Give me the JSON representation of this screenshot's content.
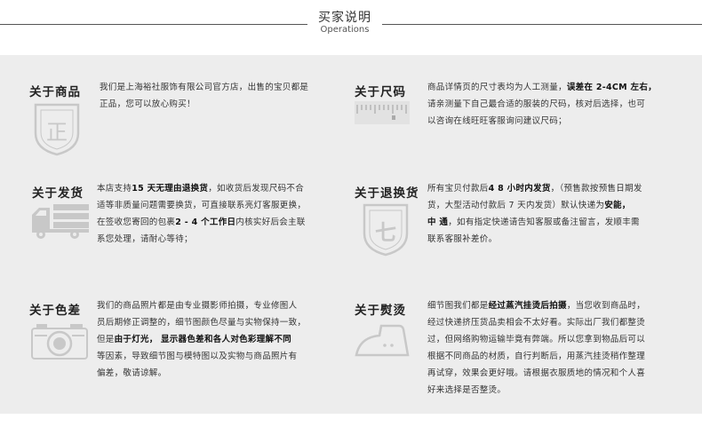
{
  "header": {
    "title": "买家说明",
    "subtitle": "Operations"
  },
  "colors": {
    "panel_bg": "#ededed",
    "icon_gray": "#c8c8c8",
    "text": "#333333"
  },
  "items": [
    {
      "id": "product",
      "title": "关于商品",
      "icon": "shield-zheng-icon",
      "icon_char": "正",
      "lines": [
        [
          {
            "t": "我们是上海裕社服饰有限公司官方店，出售的宝贝都是"
          }
        ],
        [
          {
            "t": "正品，您可以放心购买！"
          }
        ]
      ]
    },
    {
      "id": "size",
      "title": "关于尺码",
      "icon": "ruler-icon",
      "lines": [
        [
          {
            "t": "商品详情页的尺寸表均为人工测量，"
          },
          {
            "t": "误差在 2-4CM 左右，",
            "b": true
          }
        ],
        [
          {
            "t": "请亲测量下自己最合适的服装的尺码，核对后选择，也可"
          }
        ],
        [
          {
            "t": "以咨询在线旺旺客服询问建议尺码；"
          }
        ]
      ]
    },
    {
      "id": "shipping",
      "title": "关于发货",
      "icon": "truck-icon",
      "lines": [
        [
          {
            "t": "本店支持"
          },
          {
            "t": "15 天无理由退换货",
            "b": true
          },
          {
            "t": "，如收货后发现尺码不合"
          }
        ],
        [
          {
            "t": "适等非质量问题需要换货，可直接联系亮灯客服更换，"
          }
        ],
        [
          {
            "t": "在签收您寄回的包裹"
          },
          {
            "t": "2 - 4 个工作日",
            "b": true
          },
          {
            "t": "内核实好后会主联"
          }
        ],
        [
          {
            "t": "系您处理，请耐心等待；"
          }
        ]
      ]
    },
    {
      "id": "return",
      "title": "关于退换货",
      "icon": "shield-seven-icon",
      "icon_char": "七",
      "lines": [
        [
          {
            "t": "所有宝贝付款后"
          },
          {
            "t": "4 8 小时内发货",
            "b": true
          },
          {
            "t": "，（预售款按预售日期发"
          }
        ],
        [
          {
            "t": "货，大型活动付款后 7 天内发货）默认快递为"
          },
          {
            "t": "安能，",
            "b": true
          }
        ],
        [
          {
            "t": "中 通",
            "b": true
          },
          {
            "t": "，如有指定快递请告知客服或备注留言，发顺丰需"
          }
        ],
        [
          {
            "t": "联系客服补差价。"
          }
        ]
      ]
    },
    {
      "id": "color",
      "title": "关于色差",
      "icon": "camera-icon",
      "lines": [
        [
          {
            "t": "我们的商品照片都是由专业摄影师拍摄，专业修图人"
          }
        ],
        [
          {
            "t": "员后期修正调整的，细节图颜色尽量与实物保持一致，"
          }
        ],
        [
          {
            "t": "但是"
          },
          {
            "t": "由于灯光，",
            "b": true
          },
          {
            "t": "  "
          },
          {
            "t": "显示器色差和各人对色彩理解不同",
            "b": true
          }
        ],
        [
          {
            "t": "等因素，导致细节图与模特图以及实物与商品照片有"
          }
        ],
        [
          {
            "t": "偏差，敬请谅解。"
          }
        ]
      ]
    },
    {
      "id": "ironing",
      "title": "关于熨烫",
      "icon": "iron-icon",
      "lines": [
        [
          {
            "t": "细节图我们都是"
          },
          {
            "t": "经过蒸汽挂烫后拍摄",
            "b": true
          },
          {
            "t": "，当您收到商品时，"
          }
        ],
        [
          {
            "t": "经过快递挤压货品卖相会不太好看。实际出厂我们都整烫"
          }
        ],
        [
          {
            "t": "过，但网络购物运输毕竟有弊端。所以您拿到物品后可以"
          }
        ],
        [
          {
            "t": "根据不同商品的材质，自行判断后，用蒸汽挂烫稍作整理"
          }
        ],
        [
          {
            "t": "再试穿，效果会更好哦。请根据衣服质地的情况和个人喜"
          }
        ],
        [
          {
            "t": "好来选择是否整烫。"
          }
        ]
      ]
    }
  ]
}
